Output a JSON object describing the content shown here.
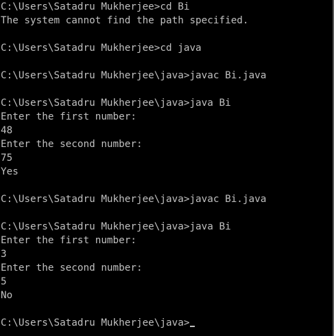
{
  "console": {
    "colors": {
      "background": "#000000",
      "foreground": "#c0c0c0"
    },
    "lines": [
      "C:\\Users\\Satadru Mukherjee>cd Bi",
      "The system cannot find the path specified.",
      "",
      "C:\\Users\\Satadru Mukherjee>cd java",
      "",
      "C:\\Users\\Satadru Mukherjee\\java>javac Bi.java",
      "",
      "C:\\Users\\Satadru Mukherjee\\java>java Bi",
      "Enter the first number:",
      "48",
      "Enter the second number:",
      "75",
      "Yes",
      "",
      "C:\\Users\\Satadru Mukherjee\\java>javac Bi.java",
      "",
      "C:\\Users\\Satadru Mukherjee\\java>java Bi",
      "Enter the first number:",
      "3",
      "Enter the second number:",
      "5",
      "No",
      "",
      "C:\\Users\\Satadru Mukherjee\\java>"
    ]
  }
}
